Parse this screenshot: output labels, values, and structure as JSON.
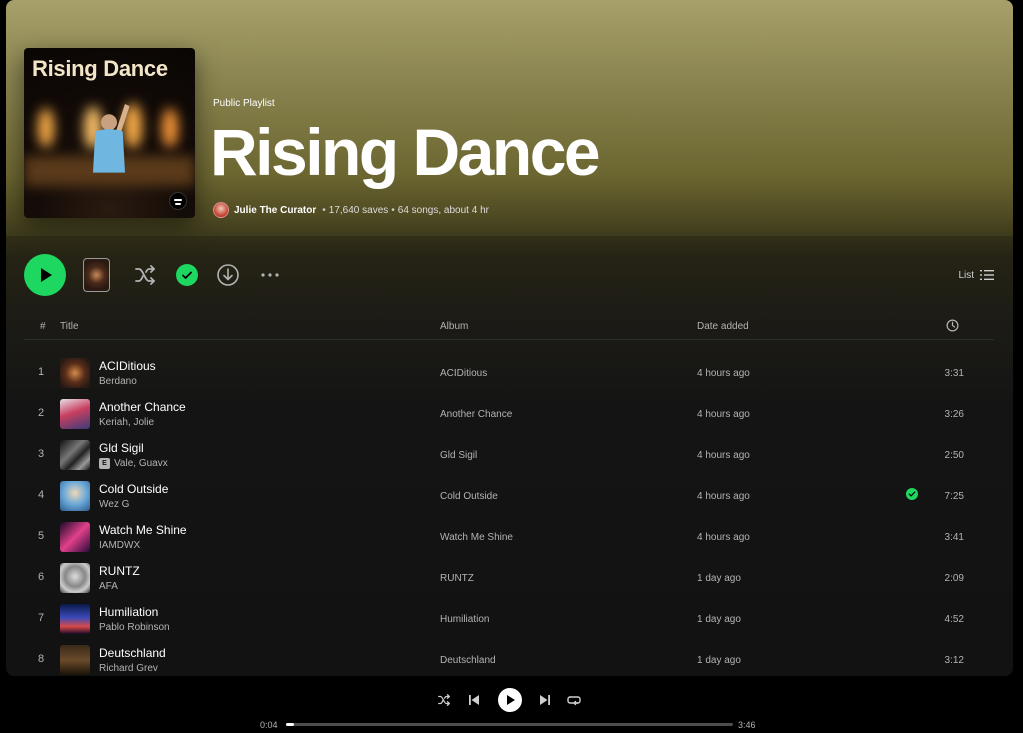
{
  "playlist": {
    "type_label": "Public Playlist",
    "title": "Rising Dance",
    "cover_title": "Rising Dance",
    "owner": "Julie The Curator",
    "saves": "17,640 saves",
    "stats": "64 songs, about 4 hr"
  },
  "toolbar": {
    "view_label": "List",
    "icons": [
      "play-icon",
      "shuffle-icon",
      "check-icon",
      "download-icon",
      "more-icon",
      "list-icon"
    ]
  },
  "columns": {
    "num": "#",
    "title": "Title",
    "album": "Album",
    "date": "Date added",
    "duration_icon": "clock-icon"
  },
  "tracks": [
    {
      "num": "1",
      "title": "ACIDitious",
      "artist": "Berdano",
      "explicit": false,
      "album": "ACIDitious",
      "added": "4 hours ago",
      "duration": "3:31",
      "downloaded": false
    },
    {
      "num": "2",
      "title": "Another Chance",
      "artist": "Keriah, Jolie",
      "explicit": false,
      "album": "Another Chance",
      "added": "4 hours ago",
      "duration": "3:26",
      "downloaded": false
    },
    {
      "num": "3",
      "title": "Gld Sigil",
      "artist": "Vale, Guavx",
      "explicit": true,
      "explicit_label": "E",
      "album": "Gld Sigil",
      "added": "4 hours ago",
      "duration": "2:50",
      "downloaded": false
    },
    {
      "num": "4",
      "title": "Cold Outside",
      "artist": "Wez G",
      "explicit": false,
      "album": "Cold Outside",
      "added": "4 hours ago",
      "duration": "7:25",
      "downloaded": true
    },
    {
      "num": "5",
      "title": "Watch Me Shine",
      "artist": "IAMDWX",
      "explicit": false,
      "album": "Watch Me Shine",
      "added": "4 hours ago",
      "duration": "3:41",
      "downloaded": false
    },
    {
      "num": "6",
      "title": "RUNTZ",
      "artist": "AFA",
      "explicit": false,
      "album": "RUNTZ",
      "added": "1 day ago",
      "duration": "2:09",
      "downloaded": false
    },
    {
      "num": "7",
      "title": "Humiliation",
      "artist": "Pablo Robinson",
      "explicit": false,
      "album": "Humiliation",
      "added": "1 day ago",
      "duration": "4:52",
      "downloaded": false
    },
    {
      "num": "8",
      "title": "Deutschland",
      "artist": "Richard Grev",
      "explicit": false,
      "album": "Deutschland",
      "added": "1 day ago",
      "duration": "3:12",
      "downloaded": false
    }
  ],
  "player": {
    "elapsed": "0:04",
    "total": "3:46",
    "progress": 0.018
  },
  "colors": {
    "accent": "#1ed760",
    "header_top": "#a7a06a",
    "background": "#121212"
  }
}
